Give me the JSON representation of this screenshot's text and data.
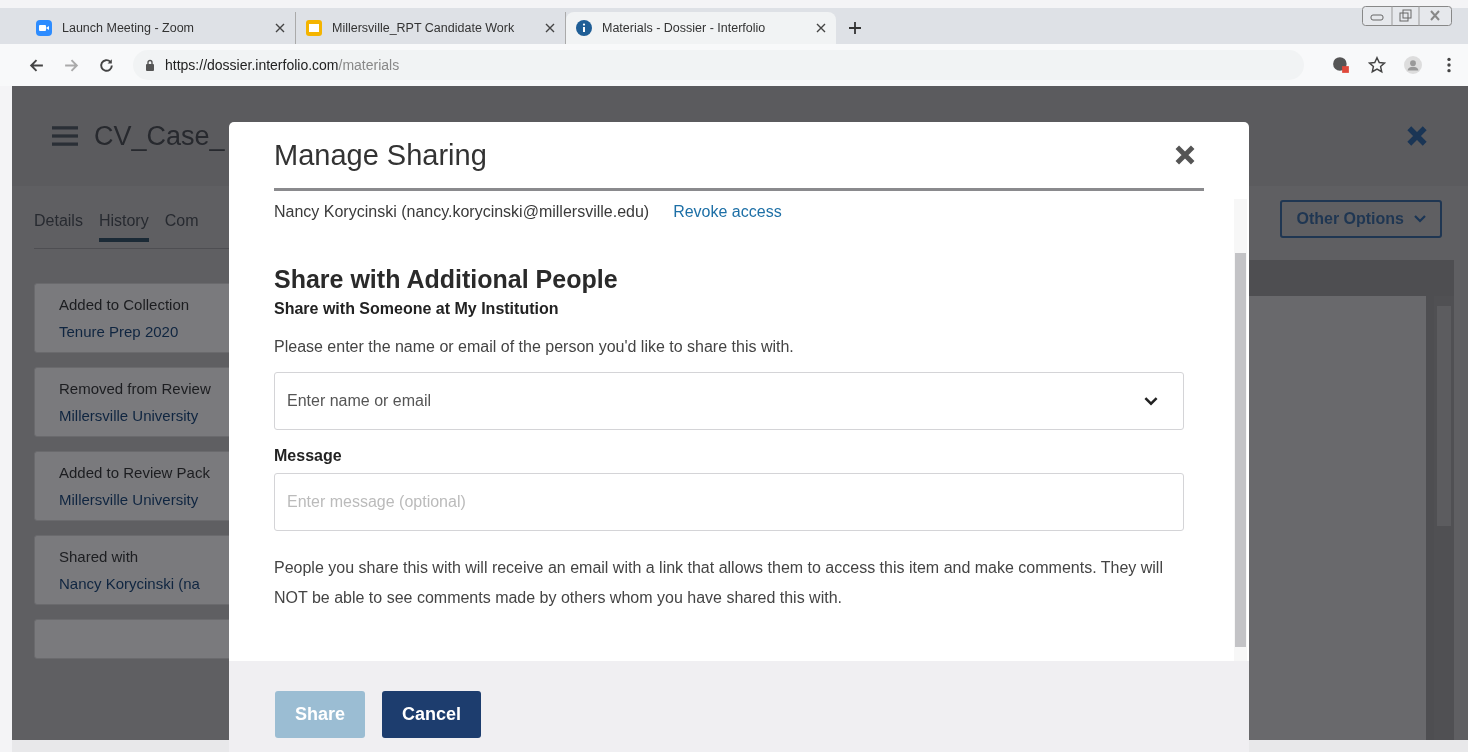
{
  "browser": {
    "tabs": [
      {
        "title": "Launch Meeting - Zoom",
        "selected": false,
        "kind": "video"
      },
      {
        "title": "Millersville_RPT Candidate Work",
        "selected": false,
        "kind": "slides"
      },
      {
        "title": "Materials - Dossier - Interfolio",
        "selected": true,
        "kind": "info"
      }
    ],
    "url_host": "https://dossier.interfolio.com",
    "url_path": "/materials"
  },
  "page": {
    "title": "CV_Case_",
    "tabs": [
      {
        "label": "Details",
        "selected": false
      },
      {
        "label": "History",
        "selected": true
      },
      {
        "label": "Com",
        "selected": false
      }
    ],
    "history": [
      {
        "event": "Added to Collection",
        "target": "Tenure Prep 2020"
      },
      {
        "event": "Removed from Review",
        "target": "Millersville University"
      },
      {
        "event": "Added to Review Pack",
        "target": "Millersville University"
      },
      {
        "event": "Shared with",
        "target": "Nancy Korycinski (na"
      }
    ],
    "other_options": "Other Options"
  },
  "modal": {
    "title": "Manage Sharing",
    "shared_with": [
      {
        "person": "Nancy Korycinski (nancy.korycinski@millersville.edu)",
        "action": "Revoke access"
      }
    ],
    "heading": "Share with Additional People",
    "subheading": "Share with Someone at My Institution",
    "instruction": "Please enter the name or email of the person you'd like to share this with.",
    "recipient_placeholder": "Enter name or email",
    "message_label": "Message",
    "message_placeholder": "Enter message (optional)",
    "note": "People you share this with will receive an email with a link that allows them to access this item and make comments. They will NOT be able to see comments made by others whom you have shared this with.",
    "buttons": [
      {
        "label": "Share",
        "disabled": true
      },
      {
        "label": "Cancel",
        "disabled": false
      }
    ]
  }
}
